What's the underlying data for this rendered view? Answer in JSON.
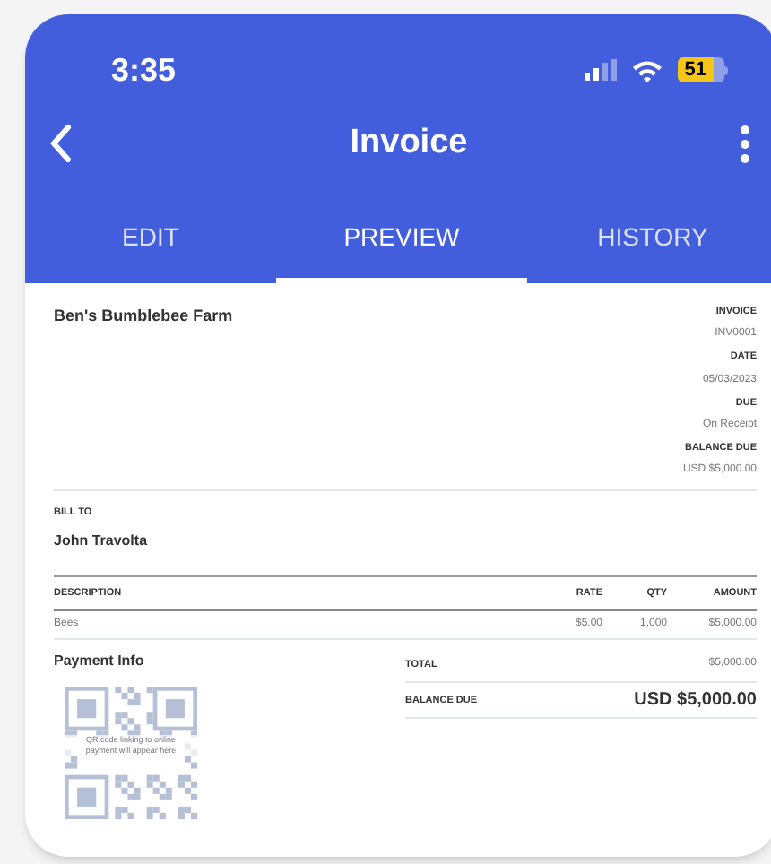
{
  "status_bar": {
    "time": "3:35",
    "battery": "51"
  },
  "app_bar": {
    "title": "Invoice"
  },
  "tabs": [
    {
      "label": "EDIT",
      "selected": false
    },
    {
      "label": "PREVIEW",
      "selected": true
    },
    {
      "label": "HISTORY",
      "selected": false
    }
  ],
  "invoice": {
    "business": "Ben's Bumblebee Farm",
    "meta": [
      {
        "label": "INVOICE",
        "value": "INV0001"
      },
      {
        "label": "DATE",
        "value": "05/03/2023"
      },
      {
        "label": "DUE",
        "value": "On Receipt"
      },
      {
        "label": "BALANCE DUE",
        "value": "USD $5,000.00"
      }
    ],
    "bill_to_label": "BILL TO",
    "bill_to": "John Travolta",
    "table": {
      "columns": [
        "DESCRIPTION",
        "RATE",
        "QTY",
        "AMOUNT"
      ],
      "rows": [
        [
          "Bees",
          "$5.00",
          "1,000",
          "$5,000.00"
        ]
      ]
    },
    "payment_info": "Payment Info",
    "qr_note": "QR code linking to online payment will appear here",
    "totals": [
      {
        "label": "TOTAL",
        "value": "$5,000.00",
        "emphasis": false
      },
      {
        "label": "BALANCE DUE",
        "value": "USD $5,000.00",
        "emphasis": true
      }
    ]
  }
}
